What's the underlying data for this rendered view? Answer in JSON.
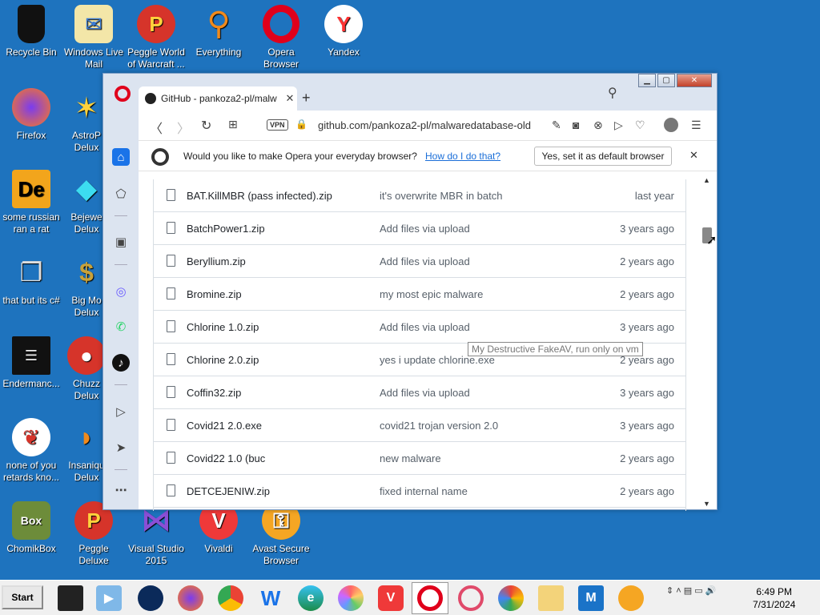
{
  "desktop": {
    "icons": [
      {
        "label": "Recycle Bin",
        "icon": "recycle-bin-icon"
      },
      {
        "label": "Windows Live Mail",
        "icon": "mail-icon"
      },
      {
        "label": "Peggle World of Warcraft ...",
        "icon": "peggle-icon"
      },
      {
        "label": "Everything",
        "icon": "search-icon"
      },
      {
        "label": "Opera Browser",
        "icon": "opera-icon"
      },
      {
        "label": "Yandex",
        "icon": "yandex-icon"
      },
      {
        "label": "Firefox",
        "icon": "firefox-icon"
      },
      {
        "label": "AstroP Delux",
        "icon": "astro-icon"
      },
      {
        "label": "some russian ran a rat",
        "icon": "de-icon"
      },
      {
        "label": "Bejewe Delux",
        "icon": "gem-icon"
      },
      {
        "label": "that but its c#",
        "icon": "windows-stack-icon"
      },
      {
        "label": "Big Mo Delux",
        "icon": "money-bag-icon"
      },
      {
        "label": "Endermanc...",
        "icon": "terminal-icon"
      },
      {
        "label": "Chuzz Delux",
        "icon": "chuzzle-icon"
      },
      {
        "label": "none of you retards kno...",
        "icon": "dragon-icon"
      },
      {
        "label": "Insaniqu Delux",
        "icon": "fish-icon"
      },
      {
        "label": "ChomikBox",
        "icon": "hamster-icon"
      },
      {
        "label": "Peggle Deluxe",
        "icon": "peggle-icon"
      },
      {
        "label": "Visual Studio 2015",
        "icon": "visual-studio-icon"
      },
      {
        "label": "Vivaldi",
        "icon": "vivaldi-icon"
      },
      {
        "label": "Avast Secure Browser",
        "icon": "avast-icon"
      }
    ]
  },
  "browser": {
    "tab_title": "GitHub - pankoza2-pl/malw",
    "url": "github.com/pankoza2-pl/malwaredatabase-old",
    "vpn_label": "VPN",
    "infobar": {
      "message": "Would you like to make Opera your everyday browser?",
      "link": "How do I do that?",
      "button": "Yes, set it as default browser"
    },
    "files": [
      {
        "name": "BAT.KillMBR (pass infected).zip",
        "message": "it's overwrite MBR in batch",
        "time": "last year"
      },
      {
        "name": "BatchPower1.zip",
        "message": "Add files via upload",
        "time": "3 years ago"
      },
      {
        "name": "Beryllium.zip",
        "message": "Add files via upload",
        "time": "2 years ago"
      },
      {
        "name": "Bromine.zip",
        "message": "my most epic malware",
        "time": "2 years ago"
      },
      {
        "name": "Chlorine 1.0.zip",
        "message": "Add files via upload",
        "time": "3 years ago"
      },
      {
        "name": "Chlorine 2.0.zip",
        "message": "yes i update chlorine.exe",
        "time": "2 years ago"
      },
      {
        "name": "Coffin32.zip",
        "message": "Add files via upload",
        "time": "3 years ago"
      },
      {
        "name": "Covid21 2.0.exe",
        "message": "covid21 trojan version 2.0",
        "time": "3 years ago"
      },
      {
        "name": "Covid22 1.0 (buc",
        "message": "new malware",
        "time": "2 years ago"
      },
      {
        "name": "DETCEJENIW.zip",
        "message": "fixed internal name",
        "time": "2 years ago"
      }
    ],
    "tooltip": "My Destructive FakeAV, run only on vm"
  },
  "taskbar": {
    "start_label": "Start",
    "clock_time": "6:49 PM",
    "clock_date": "7/31/2024"
  }
}
